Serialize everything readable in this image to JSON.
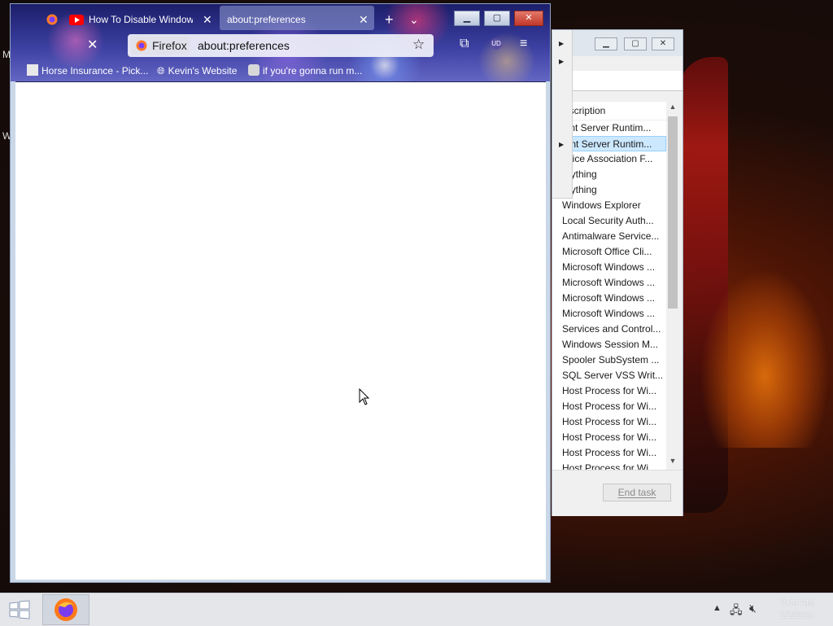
{
  "desktop": {
    "edge_letters": [
      "M",
      "W"
    ]
  },
  "firefox": {
    "tabs": [
      {
        "title": "How To Disable Window",
        "icon": "youtube-icon"
      },
      {
        "title": "about:preferences",
        "icon": "firefox-icon"
      }
    ],
    "identity_chip": "Firefox",
    "url": "about:preferences",
    "bookmarks": [
      {
        "label": "Horse Insurance - Pick...",
        "icon": "bookmark-page-icon"
      },
      {
        "label": "Kevin's Website",
        "icon": "globe-icon"
      },
      {
        "label": "if you're gonna run m...",
        "icon": "bookmark-page-icon"
      }
    ],
    "window_buttons": {
      "minimize": "▁",
      "maximize": "▢",
      "close": "✕"
    }
  },
  "task_manager": {
    "column_header": "escription",
    "rows": [
      "ient Server Runtim...",
      "ient Server Runtim...",
      "evice Association F...",
      "erything",
      "erything",
      "Windows Explorer",
      "Local Security Auth...",
      "Antimalware Service...",
      "Microsoft Office Cli...",
      "Microsoft Windows ...",
      "Microsoft Windows ...",
      "Microsoft Windows ...",
      "Microsoft Windows ...",
      "Services and Control...",
      "Windows Session M...",
      "Spooler SubSystem ...",
      "SQL Server VSS Writ...",
      "Host Process for Wi...",
      "Host Process for Wi...",
      "Host Process for Wi...",
      "Host Process for Wi...",
      "Host Process for Wi...",
      "Host Process for Wi"
    ],
    "selected_row": 1,
    "end_task_label": "End task"
  },
  "taskbar": {
    "time": "2:14 AM",
    "date": "1/2/2024"
  }
}
